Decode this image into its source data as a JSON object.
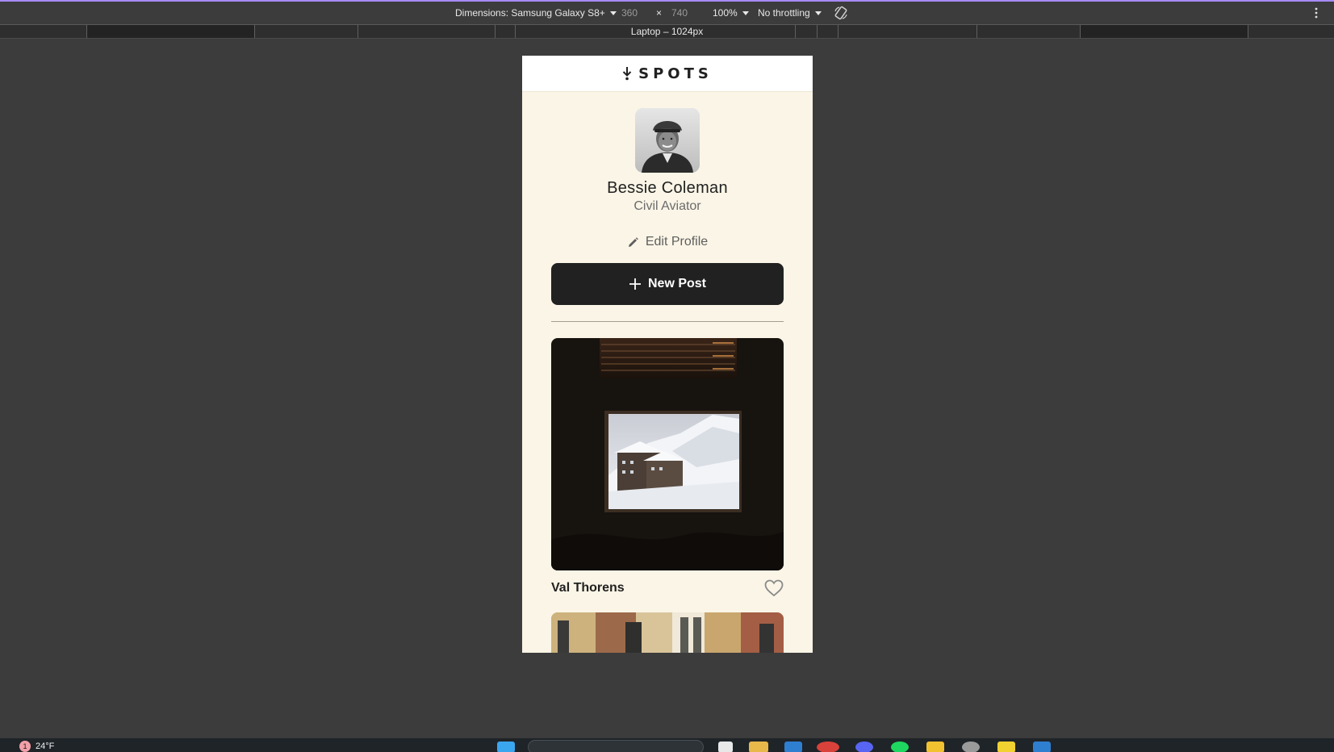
{
  "devtools": {
    "dimensions_label": "Dimensions: Samsung Galaxy S8+",
    "width": "360",
    "times": "×",
    "height": "740",
    "zoom": "100%",
    "throttling": "No throttling",
    "icons": [
      "rotate-icon",
      "more-icon"
    ]
  },
  "ruler": {
    "label": "Laptop – 1024px"
  },
  "app": {
    "logo_text": "SPOTS",
    "profile": {
      "name": "Bessie Coleman",
      "description": "Civil Aviator",
      "edit_label": "Edit Profile",
      "new_post_label": "New Post"
    },
    "cards": [
      {
        "title": "Val Thorens",
        "liked": false
      }
    ],
    "colors": {
      "background": "#faf5e6",
      "button": "#212121",
      "text": "#212121",
      "muted": "#6b6b6b"
    }
  },
  "taskbar": {
    "weather_badge": "1",
    "weather_temp": "24°F"
  }
}
